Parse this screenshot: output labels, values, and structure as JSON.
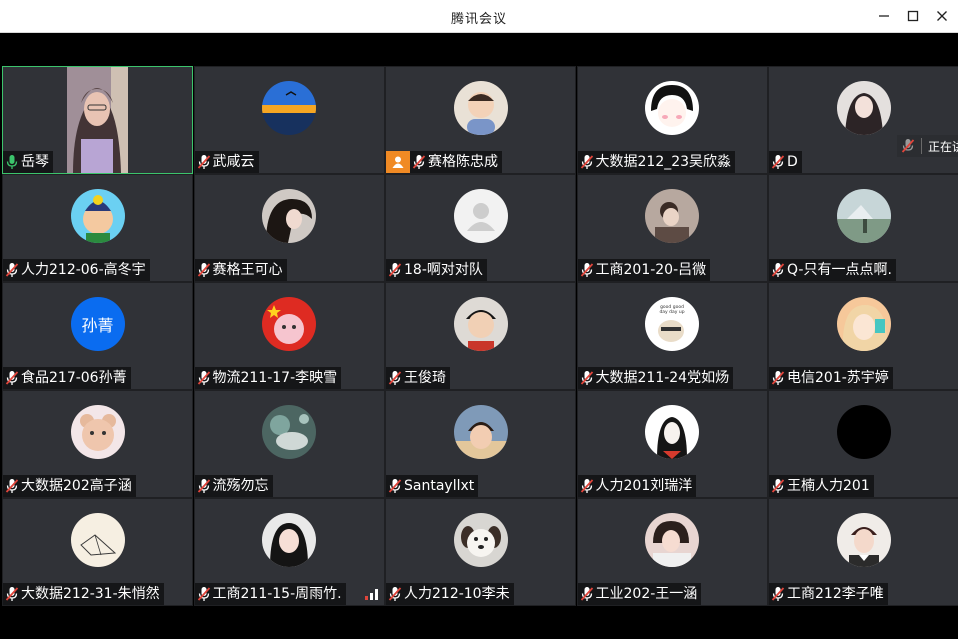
{
  "window": {
    "title": "腾讯会议"
  },
  "colors": {
    "tile_bg": "#303237",
    "active_border": "#3cc46c",
    "host_badge": "#f08a24",
    "muted_red": "#e0453b"
  },
  "speaking_indicator": {
    "text": "正在讲"
  },
  "participants": [
    {
      "name": "岳琴",
      "mic": "on",
      "kind": "video"
    },
    {
      "name": "武咸云",
      "mic": "muted",
      "kind": "landscape"
    },
    {
      "name": "赛格陈忠成",
      "mic": "muted",
      "kind": "baby",
      "host": true
    },
    {
      "name": "大数据212_23吴欣淼",
      "mic": "muted",
      "kind": "cartoon-girl"
    },
    {
      "name": "D",
      "mic": "muted",
      "kind": "girl"
    },
    {
      "name": "人力212-06-高冬宇",
      "mic": "muted",
      "kind": "cartoon-boy"
    },
    {
      "name": "赛格王可心",
      "mic": "muted",
      "kind": "dark-hair"
    },
    {
      "name": "18-啊对对队",
      "mic": "muted",
      "kind": "default"
    },
    {
      "name": "工商201-20-吕微",
      "mic": "muted",
      "kind": "photo"
    },
    {
      "name": "Q-只有一点点啊.",
      "mic": "muted",
      "kind": "scenic"
    },
    {
      "name": "食品217-06孙菁",
      "mic": "muted",
      "kind": "text",
      "initials": "孙菁"
    },
    {
      "name": "物流211-17-李映雪",
      "mic": "muted",
      "kind": "flag"
    },
    {
      "name": "王俊琦",
      "mic": "muted",
      "kind": "kid"
    },
    {
      "name": "大数据211-24党如炀",
      "mic": "muted",
      "kind": "meme",
      "caption": "good good day day up"
    },
    {
      "name": "电信201-苏宇婷",
      "mic": "muted",
      "kind": "anime"
    },
    {
      "name": "大数据202高子涵",
      "mic": "muted",
      "kind": "bear"
    },
    {
      "name": "流殇勿忘",
      "mic": "muted",
      "kind": "teal"
    },
    {
      "name": "Santayllxt",
      "mic": "muted",
      "kind": "selfie"
    },
    {
      "name": "人力201刘瑞洋",
      "mic": "muted",
      "kind": "sketch"
    },
    {
      "name": "王楠人力201",
      "mic": "muted",
      "kind": "black"
    },
    {
      "name": "大数据212-31-朱悄然",
      "mic": "muted",
      "kind": "paper"
    },
    {
      "name": "工商211-15-周雨竹.",
      "mic": "muted",
      "kind": "portrait",
      "signal": true
    },
    {
      "name": "人力212-10李未",
      "mic": "muted",
      "kind": "dog"
    },
    {
      "name": "工业202-王一涵",
      "mic": "muted",
      "kind": "hug"
    },
    {
      "name": "工商212李子唯",
      "mic": "muted",
      "kind": "guy"
    }
  ]
}
